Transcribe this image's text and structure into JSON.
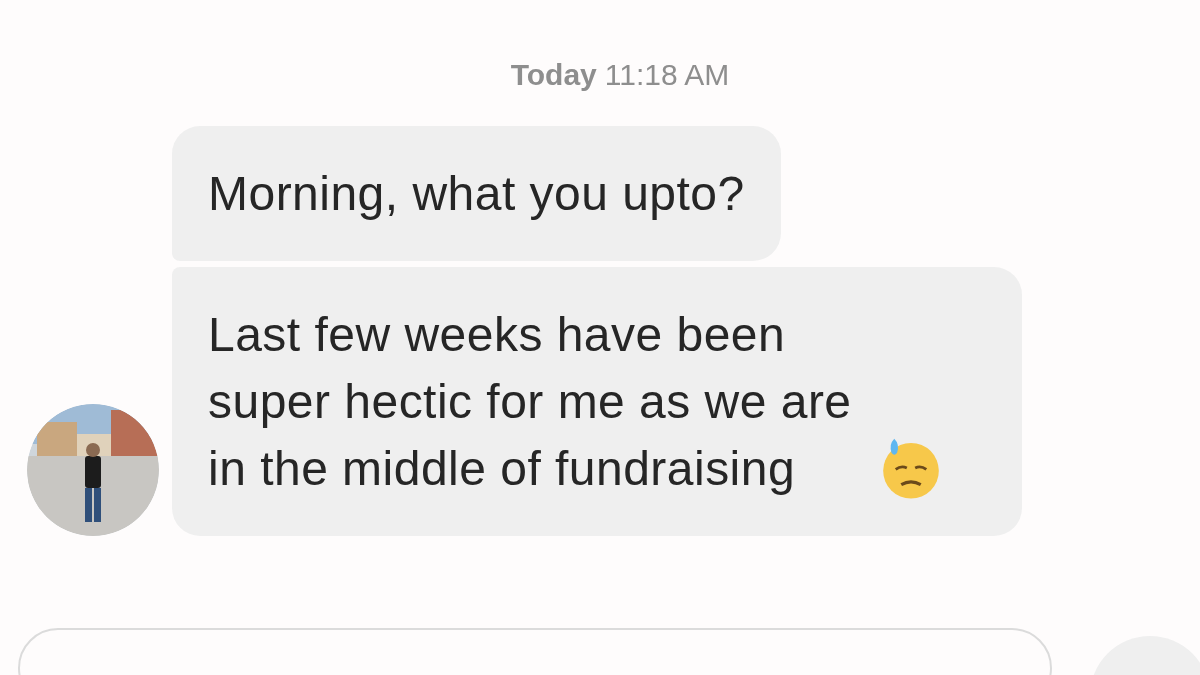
{
  "timestamp": {
    "day": "Today",
    "time": "11:18 AM"
  },
  "messages": [
    {
      "text": "Morning, what you upto?",
      "emoji": false
    },
    {
      "text": "Last few weeks have been super hectic for me as we are in the middle of fundraising",
      "emoji": true
    }
  ],
  "composer": {
    "kind": "field"
  }
}
